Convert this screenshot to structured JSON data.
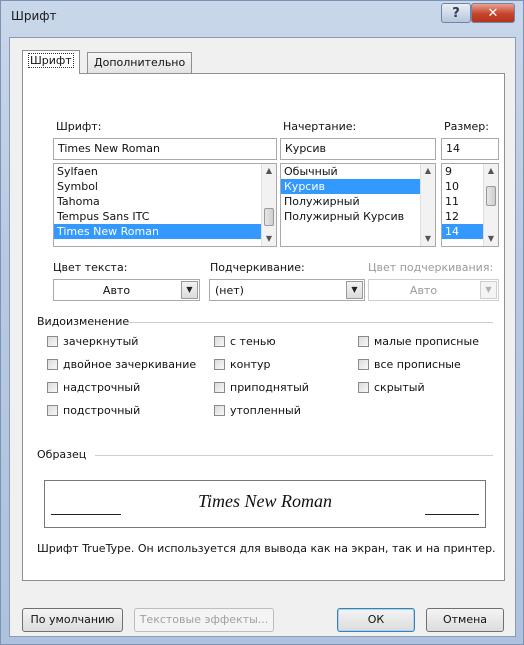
{
  "window": {
    "title": "Шрифт",
    "help_label": "?",
    "close_label": "✕"
  },
  "tabs": [
    "Шрифт",
    "Дополнительно"
  ],
  "font": {
    "label": "Шрифт:",
    "value": "Times New Roman",
    "items": [
      "Sylfaen",
      "Symbol",
      "Tahoma",
      "Tempus Sans ITC",
      "Times New Roman"
    ],
    "selected": "Times New Roman"
  },
  "style": {
    "label": "Начертание:",
    "value": "Курсив",
    "items": [
      "Обычный",
      "Курсив",
      "Полужирный",
      "Полужирный Курсив"
    ],
    "selected": "Курсив"
  },
  "size": {
    "label": "Размер:",
    "value": "14",
    "items": [
      "9",
      "10",
      "11",
      "12",
      "14"
    ],
    "selected": "14"
  },
  "text_color": {
    "label": "Цвет текста:",
    "value": "Авто"
  },
  "underline": {
    "label": "Подчеркивание:",
    "value": "(нет)"
  },
  "underline_color": {
    "label": "Цвет подчеркивания:",
    "value": "Авто"
  },
  "effects": {
    "title": "Видоизменение",
    "col1": [
      "зачеркнутый",
      "двойное зачеркивание",
      "надстрочный",
      "подстрочный"
    ],
    "col2": [
      "с тенью",
      "контур",
      "приподнятый",
      "утопленный"
    ],
    "col3": [
      "малые прописные",
      "все прописные",
      "скрытый"
    ]
  },
  "preview": {
    "title": "Образец",
    "text": "Times New Roman",
    "description": "Шрифт TrueType. Он используется для вывода как на экран, так и на принтер."
  },
  "buttons": {
    "default": "По умолчанию",
    "text_effects": "Текстовые эффекты...",
    "ok": "ОК",
    "cancel": "Отмена"
  },
  "colors": {
    "selection": "#3399ff",
    "frame": "#b7c9e2",
    "close": "#c5422b"
  }
}
